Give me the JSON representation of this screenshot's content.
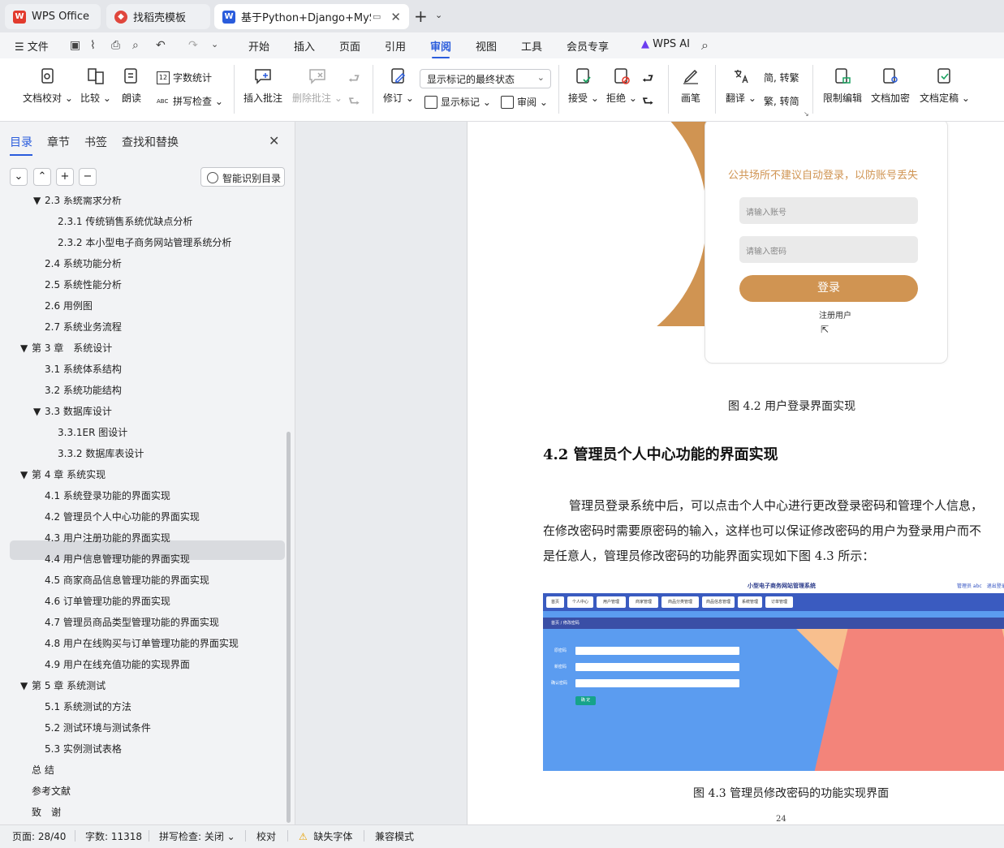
{
  "tabs": [
    {
      "label": "WPS Office",
      "icon": "wps-logo-icon",
      "color": "#e23b2e"
    },
    {
      "label": "找稻壳模板",
      "icon": "docer-icon",
      "color": "#e0473d"
    },
    {
      "label": "基于Python+Django+MySQL",
      "icon": "writer-doc-icon",
      "color": "#2a5cdc"
    }
  ],
  "menu": {
    "file_label": "文件",
    "items": [
      "开始",
      "插入",
      "页面",
      "引用",
      "审阅",
      "视图",
      "工具",
      "会员专享"
    ],
    "active": "审阅",
    "wps_ai": "WPS AI"
  },
  "ribbon": {
    "proofread": "文档校对",
    "compare": "比较",
    "read_aloud": "朗读",
    "word_count": "字数统计",
    "spell_check": "拼写检查",
    "insert_comment": "插入批注",
    "delete_comment": "删除批注",
    "track_changes": "修订",
    "markup_state": "显示标记的最终状态",
    "show_markup": "显示标记",
    "review": "审阅",
    "accept": "接受",
    "reject": "拒绝",
    "pen": "画笔",
    "translate": "翻译",
    "to_traditional": "转繁",
    "to_simplified": "转简",
    "restrict_edit": "限制编辑",
    "encrypt": "文档加密",
    "finalize": "文档定稿"
  },
  "nav": {
    "tabs": [
      "目录",
      "章节",
      "书签",
      "查找和替换"
    ],
    "smart_toc": "智能识别目录",
    "toc": [
      {
        "text": "2.3 系统需求分析",
        "level": 2,
        "expanded": true
      },
      {
        "text": "2.3.1 传统销售系统优缺点分析",
        "level": 3
      },
      {
        "text": "2.3.2 本小型电子商务网站管理系统分析",
        "level": 3
      },
      {
        "text": "2.4 系统功能分析",
        "level": 2
      },
      {
        "text": "2.5 系统性能分析",
        "level": 2
      },
      {
        "text": "2.6 用例图",
        "level": 2
      },
      {
        "text": "2.7 系统业务流程",
        "level": 2
      },
      {
        "text": "第 3 章　系统设计",
        "level": 1,
        "expanded": true
      },
      {
        "text": "3.1 系统体系结构",
        "level": 2
      },
      {
        "text": "3.2 系统功能结构",
        "level": 2
      },
      {
        "text": "3.3 数据库设计",
        "level": 2,
        "expanded": true
      },
      {
        "text": "3.3.1ER 图设计",
        "level": 3
      },
      {
        "text": "3.3.2 数据库表设计",
        "level": 3
      },
      {
        "text": "第 4 章 系统实现",
        "level": 1,
        "expanded": true,
        "selected": true
      },
      {
        "text": "4.1 系统登录功能的界面实现",
        "level": 2
      },
      {
        "text": "4.2 管理员个人中心功能的界面实现",
        "level": 2
      },
      {
        "text": "4.3 用户注册功能的界面实现",
        "level": 2
      },
      {
        "text": "4.4 用户信息管理功能的界面实现",
        "level": 2
      },
      {
        "text": "4.5 商家商品信息管理功能的界面实现",
        "level": 2
      },
      {
        "text": "4.6 订单管理功能的界面实现",
        "level": 2
      },
      {
        "text": "4.7 管理员商品类型管理功能的界面实现",
        "level": 2
      },
      {
        "text": "4.8 用户在线购买与订单管理功能的界面实现",
        "level": 2
      },
      {
        "text": "4.9 用户在线充值功能的实现界面",
        "level": 2
      },
      {
        "text": "第 5 章 系统测试",
        "level": 1,
        "expanded": true
      },
      {
        "text": "5.1 系统测试的方法",
        "level": 2
      },
      {
        "text": "5.2 测试环境与测试条件",
        "level": 2
      },
      {
        "text": "5.3 实例测试表格",
        "level": 2
      },
      {
        "text": "总 结",
        "level": 1
      },
      {
        "text": "参考文献",
        "level": 1
      },
      {
        "text": "致　谢",
        "level": 1
      }
    ]
  },
  "doc": {
    "login_tip": "公共场所不建议自动登录，以防账号丢失",
    "account_placeholder": "请输入账号",
    "password_placeholder": "请输入密码",
    "login_button": "登录",
    "register_link": "注册用户",
    "caption1": "图 4.2 用户登录界面实现",
    "heading": "4.2 管理员个人中心功能的界面实现",
    "para_lines": [
      "管理员登录系统中后，可以点击个人中心进行更改登录密码和管理个人信息，",
      "在修改密码时需要原密码的输入，这样也可以保证修改密码的用户为登录用户而不",
      "是任意人，管理员修改密码的功能界面实现如下图 4.3 所示："
    ],
    "fig2": {
      "title": "小型电子商务网站管理系统",
      "user": "管理员 abc　退出登录",
      "nav": [
        "首页",
        "个人中心",
        "用户管理",
        "商家管理",
        "商品分类管理",
        "商品信息管理",
        "系统管理",
        "订单管理"
      ],
      "crumb": "首页 / 修改密码",
      "fields": [
        "原密码",
        "新密码",
        "确认密码"
      ],
      "submit": "确 定"
    },
    "caption2": "图 4.3 管理员修改密码的功能实现界面",
    "page_number": "24"
  },
  "status": {
    "page": "页面: 28/40",
    "words": "字数: 11318",
    "spell": "拼写检查: 关闭",
    "proof": "校对",
    "missing_font": "缺失字体",
    "compat": "兼容模式"
  }
}
